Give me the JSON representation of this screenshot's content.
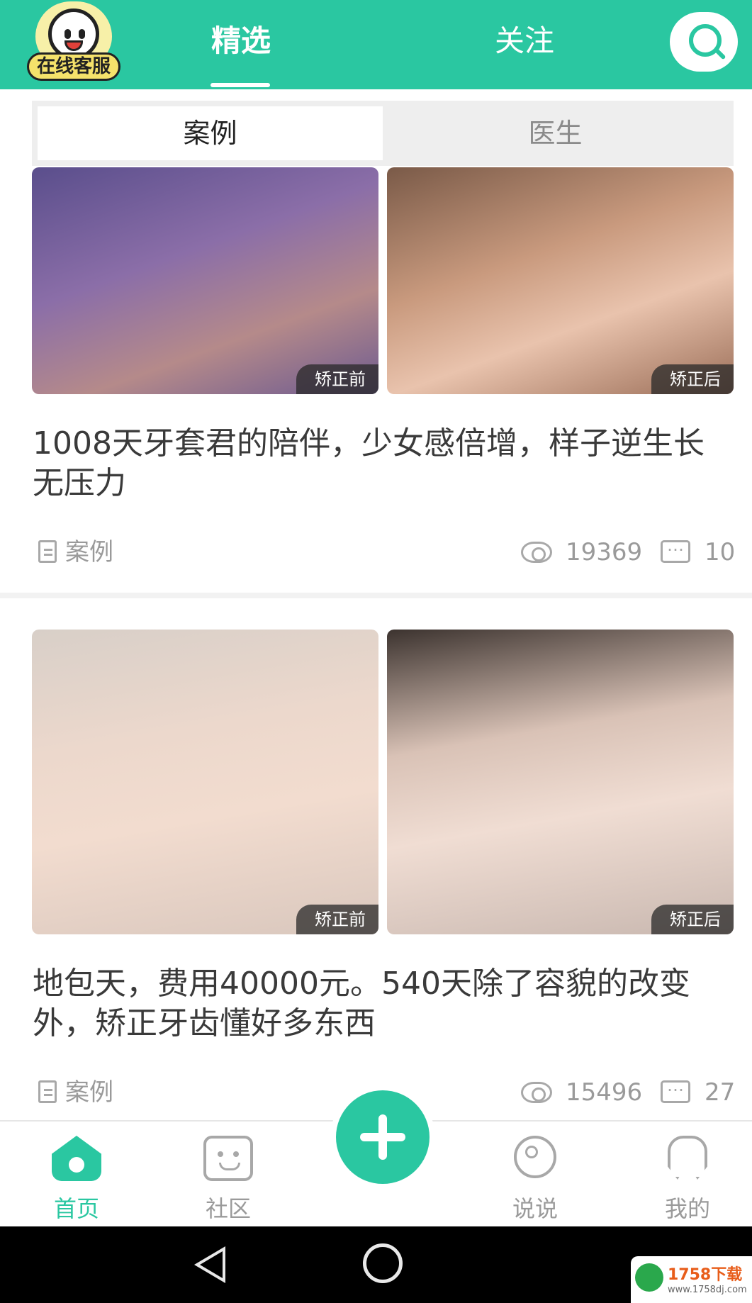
{
  "header": {
    "service_badge": "在线客服",
    "tabs": [
      {
        "label": "精选",
        "active": true
      },
      {
        "label": "关注",
        "active": false
      }
    ],
    "search_icon": "search-icon"
  },
  "segment": {
    "tabs": [
      {
        "label": "案例",
        "active": true
      },
      {
        "label": "医生",
        "active": false
      }
    ]
  },
  "cards": [
    {
      "before_tag": "矫正前",
      "after_tag": "矫正后",
      "title": "1008天牙套君的陪伴，少女感倍增，样子逆生长无压力",
      "category": "案例",
      "views": "19369",
      "comments": "10"
    },
    {
      "before_tag": "矫正前",
      "after_tag": "矫正后",
      "title": "地包天，费用40000元。540天除了容貌的改变外，矫正牙齿懂好多东西",
      "category": "案例",
      "views": "15496",
      "comments": "27"
    }
  ],
  "bottom_nav": {
    "items": [
      {
        "label": "首页",
        "icon": "home-icon",
        "active": true
      },
      {
        "label": "社区",
        "icon": "chat-icon",
        "active": false
      },
      {
        "label": "说说",
        "icon": "moon-icon",
        "active": false
      },
      {
        "label": "我的",
        "icon": "tooth-icon",
        "active": false
      }
    ],
    "fab_icon": "plus-icon"
  },
  "watermark": {
    "text": "1758下载",
    "sub": "www.1758dj.com"
  },
  "colors": {
    "accent": "#2ac7a1",
    "muted": "#9a9a9a",
    "title": "#3a3a3a"
  }
}
